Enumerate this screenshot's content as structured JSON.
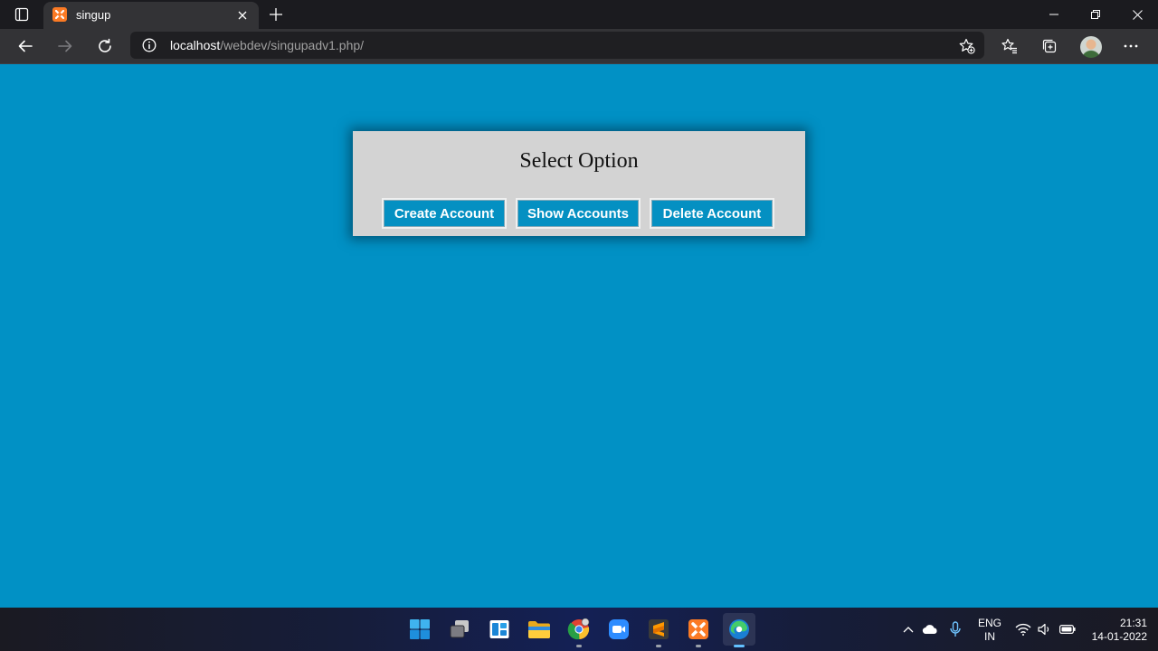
{
  "browser": {
    "tab": {
      "title": "singup"
    },
    "address": {
      "host": "localhost",
      "path": "/webdev/singupadv1.php/"
    }
  },
  "page": {
    "card_title": "Select Option",
    "buttons": {
      "create": "Create Account",
      "show": "Show Accounts",
      "delete": "Delete Account"
    }
  },
  "taskbar": {
    "language": {
      "line1": "ENG",
      "line2": "IN"
    },
    "clock": {
      "time": "21:31",
      "date": "14-01-2022"
    }
  },
  "colors": {
    "page_background": "#0191c5",
    "card_background": "#d3d3d3",
    "button_background": "#0490c2",
    "xampp_orange": "#fb7a24"
  }
}
